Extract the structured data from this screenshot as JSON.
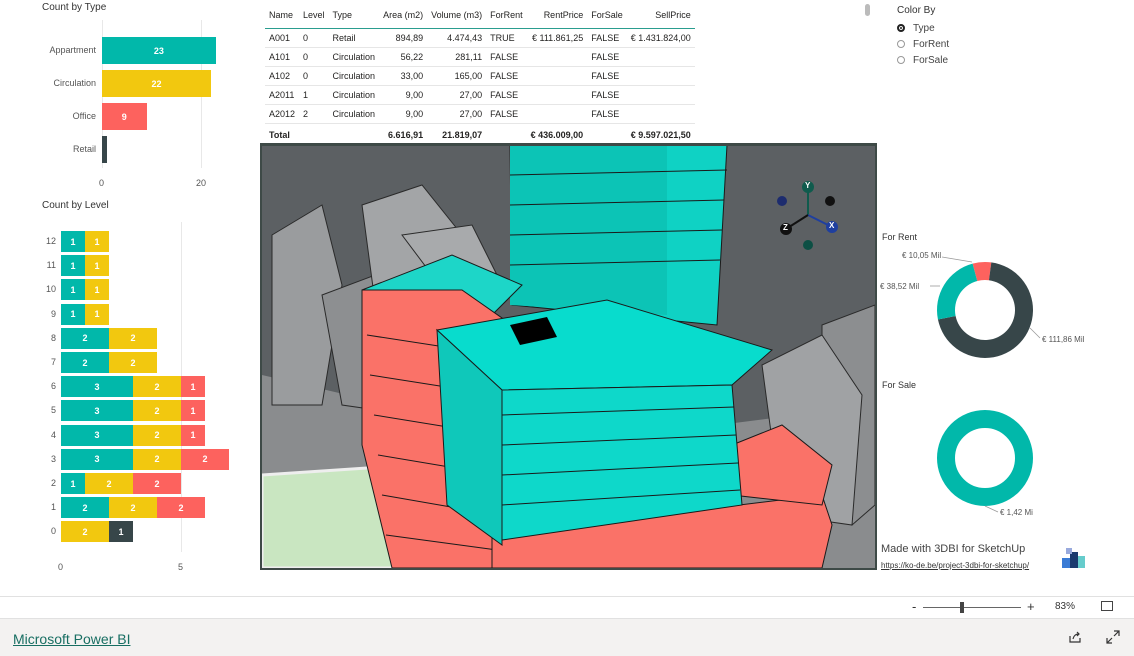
{
  "type_chart": {
    "title": "Count by Type",
    "categories": [
      "Appartment",
      "Circulation",
      "Office",
      "Retail"
    ],
    "values": [
      23,
      22,
      9,
      1
    ],
    "colors": [
      "#01b8aa",
      "#f2c80f",
      "#fd625e",
      "#374649"
    ],
    "value_labels": [
      "23",
      "22",
      "9",
      ""
    ],
    "axis_ticks": [
      "0",
      "20"
    ]
  },
  "level_chart": {
    "title": "Count by Level",
    "levels": [
      "12",
      "11",
      "10",
      "9",
      "8",
      "7",
      "6",
      "5",
      "4",
      "3",
      "2",
      "1",
      "0"
    ],
    "segments": [
      [
        {
          "v": 1,
          "c": "#01b8aa",
          "t": "#fff"
        },
        {
          "v": 1,
          "c": "#f2c80f",
          "t": "#fff"
        }
      ],
      [
        {
          "v": 1,
          "c": "#01b8aa",
          "t": "#fff"
        },
        {
          "v": 1,
          "c": "#f2c80f",
          "t": "#fff"
        }
      ],
      [
        {
          "v": 1,
          "c": "#01b8aa",
          "t": "#fff"
        },
        {
          "v": 1,
          "c": "#f2c80f",
          "t": "#fff"
        }
      ],
      [
        {
          "v": 1,
          "c": "#01b8aa",
          "t": "#fff"
        },
        {
          "v": 1,
          "c": "#f2c80f",
          "t": "#fff"
        }
      ],
      [
        {
          "v": 2,
          "c": "#01b8aa",
          "t": "#fff"
        },
        {
          "v": 2,
          "c": "#f2c80f",
          "t": "#fff"
        }
      ],
      [
        {
          "v": 2,
          "c": "#01b8aa",
          "t": "#fff"
        },
        {
          "v": 2,
          "c": "#f2c80f",
          "t": "#fff"
        }
      ],
      [
        {
          "v": 3,
          "c": "#01b8aa",
          "t": "#fff"
        },
        {
          "v": 2,
          "c": "#f2c80f",
          "t": "#fff"
        },
        {
          "v": 1,
          "c": "#fd625e",
          "t": "#fff"
        }
      ],
      [
        {
          "v": 3,
          "c": "#01b8aa",
          "t": "#fff"
        },
        {
          "v": 2,
          "c": "#f2c80f",
          "t": "#fff"
        },
        {
          "v": 1,
          "c": "#fd625e",
          "t": "#fff"
        }
      ],
      [
        {
          "v": 3,
          "c": "#01b8aa",
          "t": "#fff"
        },
        {
          "v": 2,
          "c": "#f2c80f",
          "t": "#fff"
        },
        {
          "v": 1,
          "c": "#fd625e",
          "t": "#fff"
        }
      ],
      [
        {
          "v": 3,
          "c": "#01b8aa",
          "t": "#fff"
        },
        {
          "v": 2,
          "c": "#f2c80f",
          "t": "#fff"
        },
        {
          "v": 2,
          "c": "#fd625e",
          "t": "#fff"
        }
      ],
      [
        {
          "v": 1,
          "c": "#01b8aa",
          "t": "#fff"
        },
        {
          "v": 2,
          "c": "#f2c80f",
          "t": "#fff"
        },
        {
          "v": 2,
          "c": "#fd625e",
          "t": "#fff"
        }
      ],
      [
        {
          "v": 2,
          "c": "#01b8aa",
          "t": "#fff"
        },
        {
          "v": 2,
          "c": "#f2c80f",
          "t": "#fff"
        },
        {
          "v": 2,
          "c": "#fd625e",
          "t": "#fff"
        }
      ],
      [
        {
          "v": 2,
          "c": "#f2c80f",
          "t": "#fff"
        },
        {
          "v": 1,
          "c": "#374649",
          "t": "#fff"
        }
      ]
    ],
    "axis_ticks": [
      "0",
      "5"
    ]
  },
  "table": {
    "headers": [
      "Name",
      "Level",
      "Type",
      "Area (m2)",
      "Volume (m3)",
      "ForRent",
      "RentPrice",
      "ForSale",
      "SellPrice"
    ],
    "rows": [
      [
        "A001",
        "0",
        "Retail",
        "894,89",
        "4.474,43",
        "TRUE",
        "€ 111.861,25",
        "FALSE",
        "€ 1.431.824,00"
      ],
      [
        "A101",
        "0",
        "Circulation",
        "56,22",
        "281,11",
        "FALSE",
        "",
        "FALSE",
        ""
      ],
      [
        "A102",
        "0",
        "Circulation",
        "33,00",
        "165,00",
        "FALSE",
        "",
        "FALSE",
        ""
      ],
      [
        "A2011",
        "1",
        "Circulation",
        "9,00",
        "27,00",
        "FALSE",
        "",
        "FALSE",
        ""
      ],
      [
        "A2012",
        "2",
        "Circulation",
        "9,00",
        "27,00",
        "FALSE",
        "",
        "FALSE",
        ""
      ]
    ],
    "total": [
      "Total",
      "",
      "",
      "6.616,91",
      "21.819,07",
      "",
      "€ 436.009,00",
      "",
      "€ 9.597.021,50"
    ]
  },
  "color_by": {
    "title": "Color By",
    "options": [
      "Type",
      "ForRent",
      "ForSale"
    ],
    "selected": "Type"
  },
  "axes_gizmo": {
    "y": "Y",
    "x": "X",
    "z": "Z"
  },
  "for_rent": {
    "title": "For Rent",
    "labels": [
      "€ 10,05 Mil",
      "€ 38,52 Mil",
      "€ 111,86 Mil"
    ],
    "values": [
      10.05,
      38.52,
      111.86
    ],
    "colors": [
      "#fd625e",
      "#01b8aa",
      "#374649"
    ]
  },
  "for_sale": {
    "title": "For Sale",
    "labels": [
      "€ 1,42 Mi"
    ],
    "values": [
      1.42
    ],
    "colors": [
      "#01b8aa"
    ]
  },
  "credit": {
    "text": "Made with 3DBI for SketchUp",
    "link": "https://ko-de.be/project-3dbi-for-sketchup/"
  },
  "zoom": {
    "minus": "-",
    "plus": "+",
    "value": "83%"
  },
  "footer": {
    "brand": "Microsoft Power BI"
  }
}
